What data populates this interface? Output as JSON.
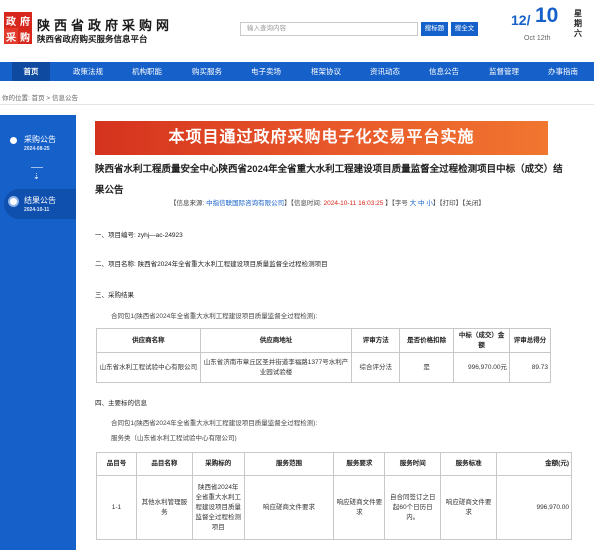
{
  "header": {
    "logo": [
      "政府",
      "采购"
    ],
    "site_title": "陕西省政府采购网",
    "site_subtitle": "陕西省政府购买服务信息平台",
    "search_placeholder": "输入查询内容",
    "search_button": "搜标题",
    "fulltext_button": "搜全文",
    "date_month": "12/",
    "date_day": "10",
    "date_en": "Oct 12th",
    "weekday": "星期六",
    "brand_color": "#1560c9"
  },
  "nav": {
    "items": [
      "首页",
      "政策法规",
      "机构职能",
      "购买服务",
      "电子卖场",
      "框架协议",
      "资讯动态",
      "信息公告",
      "监督管理",
      "办事指南"
    ]
  },
  "breadcrumb": {
    "prefix": "你的位置:",
    "home": "首页",
    "sep": " > ",
    "current": "信息公告"
  },
  "timeline": {
    "items": [
      {
        "label": "采购公告",
        "date": "2024-08-25"
      },
      {
        "label": "结果公告",
        "date": "2024-10-11"
      }
    ],
    "arrow": "⇣"
  },
  "content": {
    "banner": "本项目通过政府采购电子化交易平台实施",
    "title": "陕西省水利工程质量安全中心陕西省2024年全省重大水利工程建设项目质量监督全过程检测项目中标（成交）结果公告",
    "source": {
      "open": "【信息来源: ",
      "source_name": "中指信联国际咨询有限公司",
      "time_label": "】【信息时间: ",
      "time_value": "2024-10-11 16:03:25",
      "font_label": " 】【字号 ",
      "font_sizes": "大 中 小",
      "print": "】【打印】",
      "close": "【关闭】"
    },
    "s1": "一、项目编号: zyhj—ac-24923",
    "s2": "二、项目名称: 陕西省2024年全省重大水利工程建设项目质量监督全过程检测项目",
    "s3": "三、采购结果",
    "s3_para": "合同包1(陕西省2024年全省重大水利工程建设项目质量监督全过程检测):",
    "table1": {
      "headers": [
        "供应商名称",
        "供应商地址",
        "评审方法",
        "是否价格扣除",
        "中标（成交）金额",
        "评审总得分"
      ],
      "rows": [
        [
          "山东省水利工程试验中心有限公司",
          "山东省济南市章丘区圣井街道李福路1377号水利产业园试验楼",
          "综合评分法",
          "是",
          "996,970.00元",
          "89.73"
        ]
      ]
    },
    "s4": "四、主要标的信息",
    "s4_para1": "合同包1(陕西省2024年全省重大水利工程建设项目质量监督全过程检测):",
    "s4_para2": "服务类（山东省水利工程试验中心有限公司)",
    "table2": {
      "headers": [
        "品目号",
        "品目名称",
        "采购标的",
        "服务范围",
        "服务要求",
        "服务时间",
        "服务标准",
        "金额(元)"
      ],
      "rows": [
        [
          "1-1",
          "其他水利管理服务",
          "陕西省2024年全省重大水利工程建设项目质量监督全过程检测项目",
          "响应磋商文件要求",
          "响应磋商文件要求",
          "自合同签订之日起60个日历日内。",
          "响应磋商文件要求",
          "996,970.00"
        ]
      ]
    }
  }
}
